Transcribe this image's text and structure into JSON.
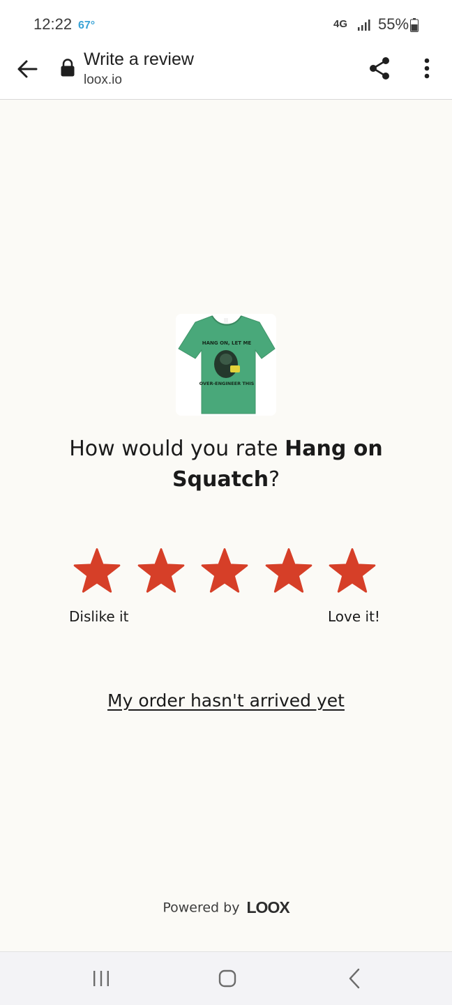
{
  "status_bar": {
    "time": "12:22",
    "temperature": "67°",
    "network": "4G",
    "battery": "55%"
  },
  "toolbar": {
    "title": "Write a review",
    "url": "loox.io",
    "icons": [
      "back-arrow-icon",
      "lock-icon",
      "share-icon",
      "more-vert-icon"
    ]
  },
  "product": {
    "image_label": "Hang on Squatch t-shirt",
    "shirt_text_top": "HANG ON, LET ME",
    "shirt_text_bottom": "OVER-ENGINEER THIS",
    "shirt_color": "#49a87a"
  },
  "rating": {
    "question_prefix": "How would you rate ",
    "product_name": "Hang on Squatch",
    "question_suffix": "?",
    "stars": 5,
    "star_color": "#d63f28",
    "low_label": "Dislike it",
    "high_label": "Love it!"
  },
  "order_link": "My order hasn't arrived yet",
  "footer": {
    "powered_by": "Powered by",
    "brand": "LOOX"
  },
  "nav_bar": {
    "icons": [
      "recents-icon",
      "home-icon",
      "back-icon"
    ]
  }
}
